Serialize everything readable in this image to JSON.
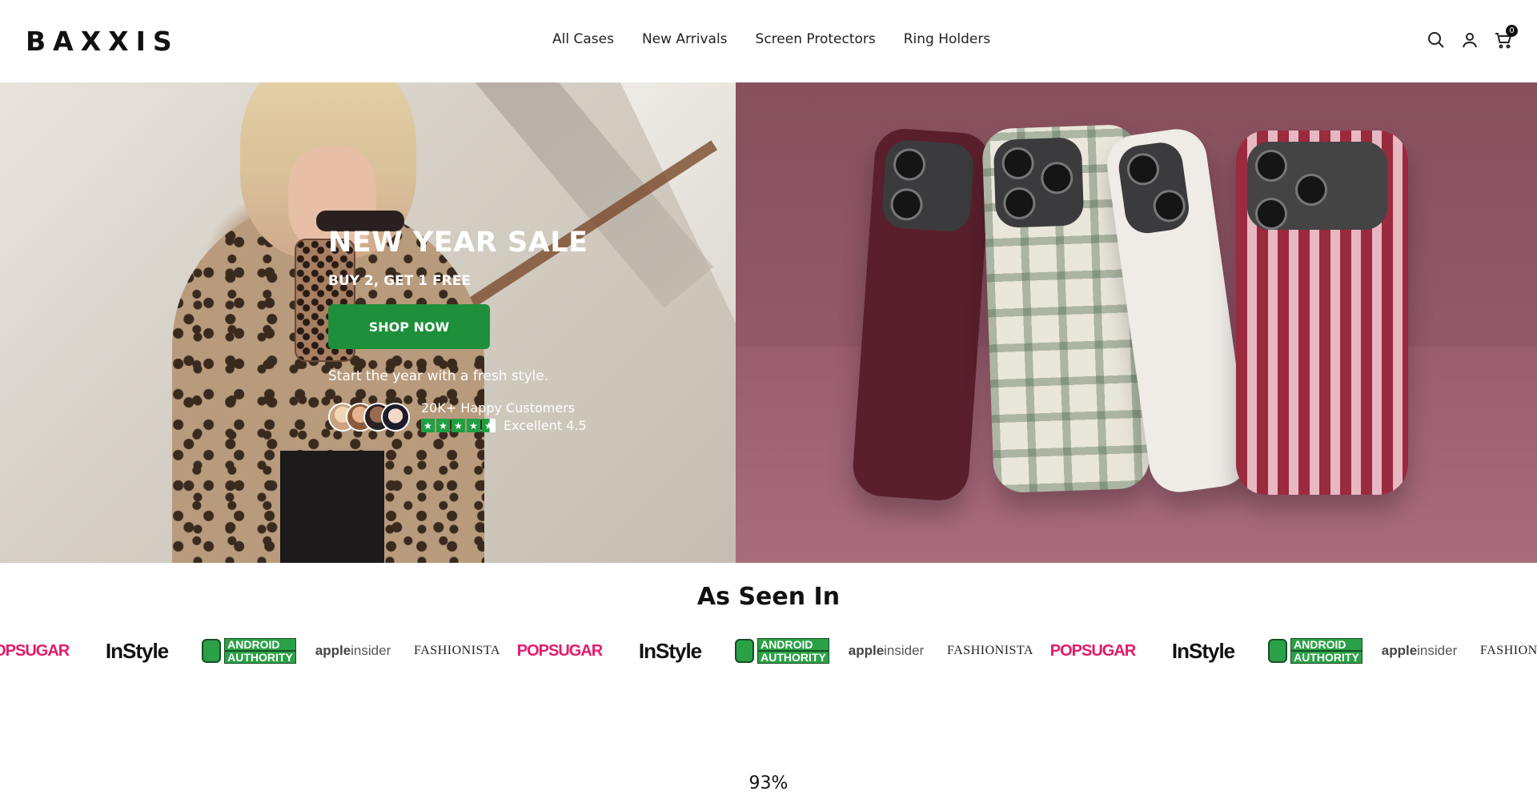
{
  "brand": "BAXXIS",
  "nav": {
    "items": [
      "All Cases",
      "New Arrivals",
      "Screen Protectors",
      "Ring Holders"
    ]
  },
  "header_icons": {
    "search": "search-icon",
    "account": "user-icon",
    "cart": "cart-icon",
    "cart_count": "0"
  },
  "hero": {
    "title": "NEW YEAR SALE",
    "subtitle": "BUY 2, GET 1 FREE",
    "cta_label": "SHOP NOW",
    "tagline": "Start the year with a fresh style.",
    "customers_text": "20K+ Happy Customers",
    "rating_text": "Excellent 4.5",
    "rating_value": 4.5,
    "accent_color": "#1e8f3a"
  },
  "press": {
    "title": "As Seen In",
    "logos": [
      "POPSUGAR",
      "InStyle",
      "ANDROID AUTHORITY",
      "appleinsider",
      "FASHIONISTA"
    ]
  },
  "stat": {
    "value": "93%"
  }
}
